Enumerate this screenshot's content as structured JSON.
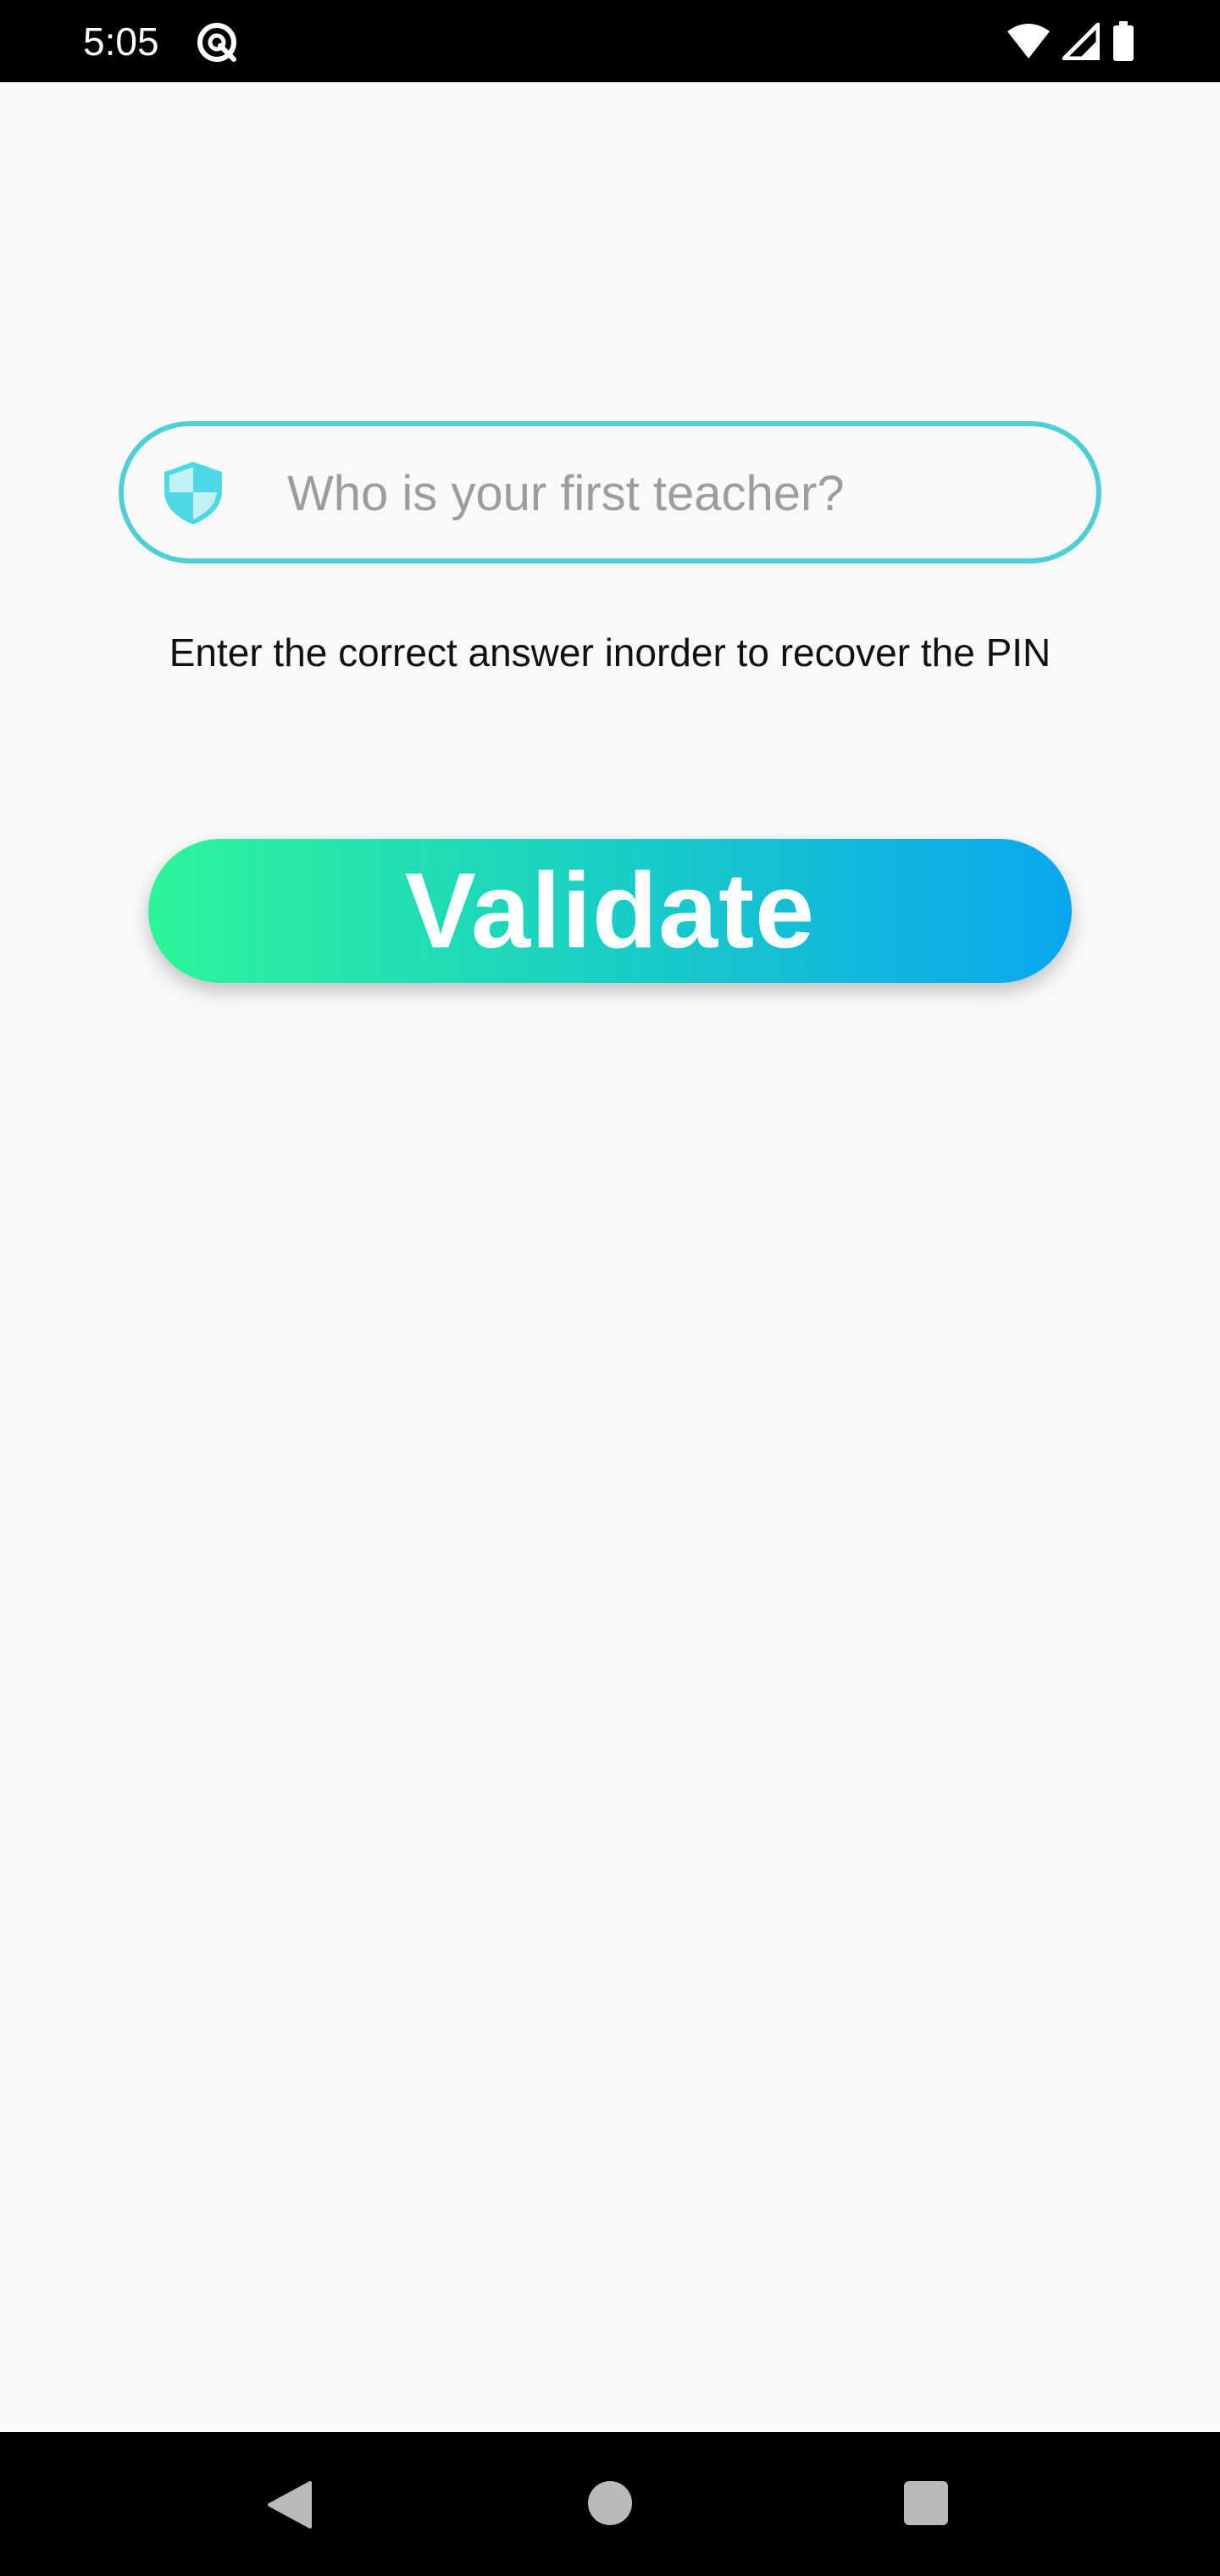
{
  "status_bar": {
    "time": "5:05",
    "icons": [
      "sync-icon",
      "wifi-icon",
      "signal-icon",
      "battery-icon"
    ]
  },
  "security_question": {
    "icon": "shield-icon",
    "value": "",
    "placeholder": "Who is your first teacher?"
  },
  "hint": {
    "text": "Enter the correct answer inorder to recover the PIN"
  },
  "validate_button": {
    "label": "Validate"
  },
  "nav_bar": {
    "icons": [
      "back-icon",
      "home-icon",
      "recents-icon"
    ]
  },
  "colors": {
    "field_border": "#4ecfd8",
    "shield": "#4dd8e6",
    "button_gradient_start": "#2cf59a",
    "button_gradient_end": "#0aa6ee",
    "background": "#f9f9f9"
  }
}
